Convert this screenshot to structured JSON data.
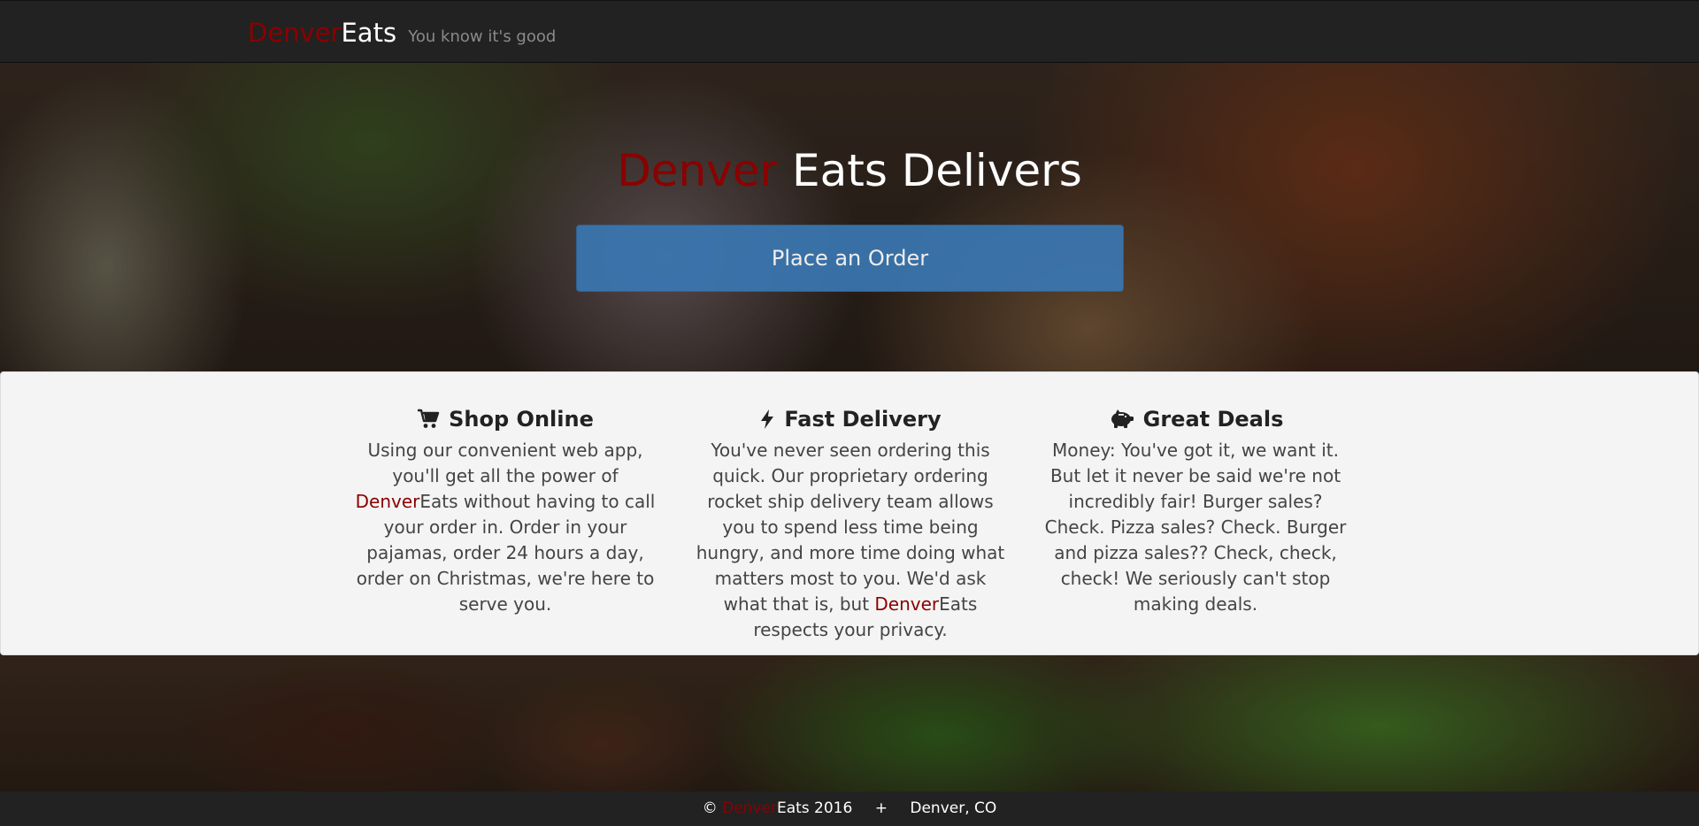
{
  "navbar": {
    "brand_red": "Denver",
    "brand_white": "Eats",
    "tagline": "You know it's good"
  },
  "hero": {
    "title_red": "Denver",
    "title_rest": " Eats Delivers",
    "order_button": "Place an Order"
  },
  "features": [
    {
      "icon": "cart-icon",
      "title": "Shop Online",
      "text_before": "Using our convenient web app, you'll get all the power of ",
      "highlight_red": "Denver",
      "highlight_plain": "Eats",
      "text_after": " without having to call your order in. Order in your pajamas, order 24 hours a day, order on Christmas, we're here to serve you."
    },
    {
      "icon": "lightning-icon",
      "title": "Fast Delivery",
      "text_before": "You've never seen ordering this quick. Our proprietary ordering rocket ship delivery team allows you to spend less time being hungry, and more time doing what matters most to you. We'd ask what that is, but ",
      "highlight_red": "Denver",
      "highlight_plain": "Eats",
      "text_after": " respects your privacy."
    },
    {
      "icon": "piggy-bank-icon",
      "title": "Great Deals",
      "text": "Money: You've got it, we want it. But let it never be said we're not incredibly fair! Burger sales? Check. Pizza sales? Check. Burger and pizza sales?? Check, check, check! We seriously can't stop making deals."
    }
  ],
  "footer": {
    "copyright": "©",
    "brand_red": "Denver",
    "brand_white": "Eats 2016",
    "separator": "+",
    "location": "Denver, CO"
  },
  "colors": {
    "brand_red": "#8b0000",
    "navbar_bg": "#222222",
    "button_blue": "#3a77b2",
    "panel_bg": "#f4f4f4"
  }
}
